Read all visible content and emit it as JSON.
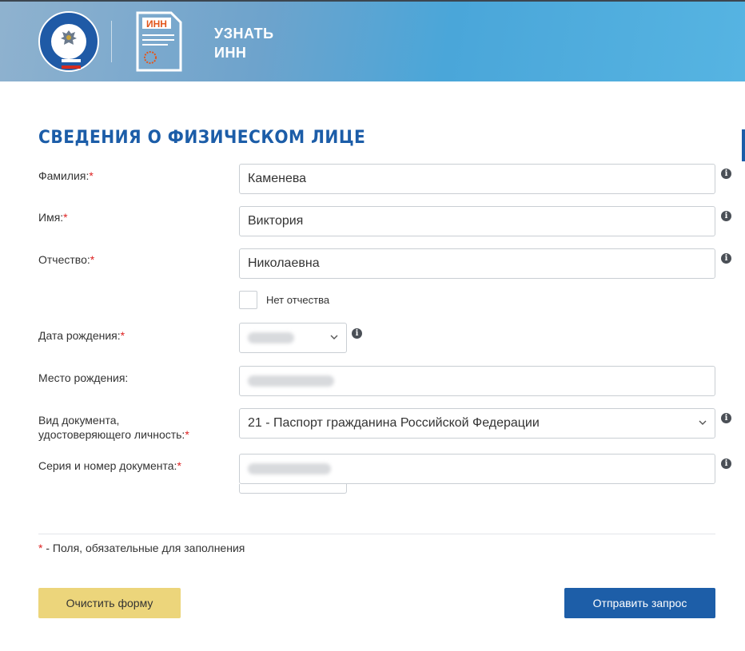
{
  "header": {
    "title_line1": "УЗНАТЬ",
    "title_line2": "ИНН",
    "doc_badge": "ИНН"
  },
  "section": {
    "title": "СВЕДЕНИЯ О ФИЗИЧЕСКОМ ЛИЦЕ"
  },
  "fields": {
    "surname": {
      "label": "Фамилия:",
      "value": "Каменева"
    },
    "name": {
      "label": "Имя:",
      "value": "Виктория"
    },
    "patronymic": {
      "label": "Отчество:",
      "value": "Николаевна"
    },
    "no_patronymic": {
      "label": "Нет отчества"
    },
    "birth_date": {
      "label": "Дата рождения:"
    },
    "birth_place": {
      "label": "Место рождения:"
    },
    "doc_type": {
      "label_line1": "Вид документа,",
      "label_line2": "удостоверяющего личность:",
      "value": "21 - Паспорт гражданина Российской Федерации"
    },
    "doc_number": {
      "label": "Серия и номер документа:"
    }
  },
  "required_mark": "*",
  "note": {
    "star": "*",
    "text": " - Поля, обязательные для заполнения"
  },
  "buttons": {
    "clear": "Очистить форму",
    "send": "Отправить запрос"
  },
  "icons": {
    "info": "info-icon",
    "chevron": "chevron-down-icon"
  },
  "colors": {
    "accent": "#1c5da8",
    "clear_button": "#ecd57b",
    "send_button": "#1d5ea8",
    "required": "#dd2222"
  }
}
